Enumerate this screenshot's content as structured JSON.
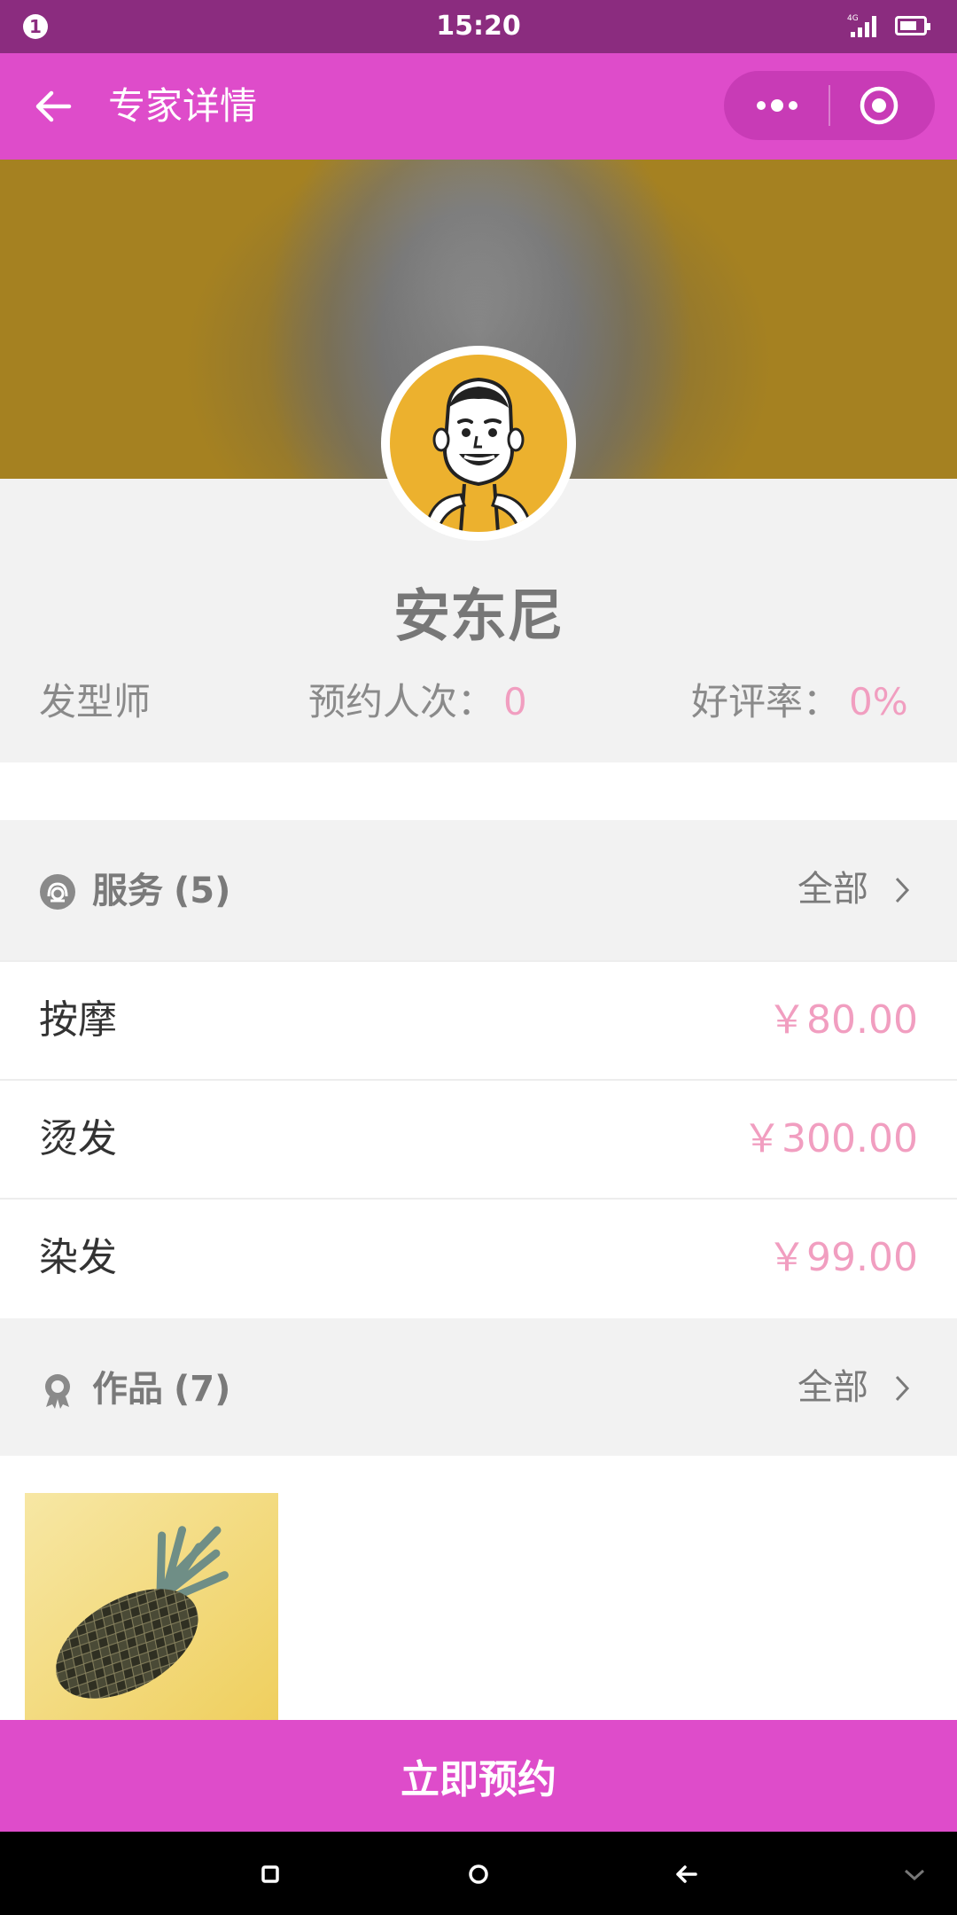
{
  "status_bar": {
    "notification": "1",
    "time": "15:20",
    "network": "4G"
  },
  "nav": {
    "title": "专家详情"
  },
  "expert": {
    "name": "安东尼",
    "role": "发型师",
    "bookings_label": "预约人次：",
    "bookings_value": "0",
    "rating_label": "好评率：",
    "rating_value": "0%"
  },
  "services": {
    "title": "服务",
    "count": "(5)",
    "more": "全部",
    "items": [
      {
        "name": "按摩",
        "price": "￥80.00"
      },
      {
        "name": "烫发",
        "price": "￥300.00"
      },
      {
        "name": "染发",
        "price": "￥99.00"
      }
    ]
  },
  "works": {
    "title": "作品",
    "count": "(7)",
    "more": "全部"
  },
  "actions": {
    "book": "立即预约"
  },
  "colors": {
    "accent": "#de4cca",
    "status_bar": "#8b2c7f",
    "price": "#f19ec0",
    "avatar_bg": "#ecb12e"
  },
  "icons": {
    "back": "arrow-left-icon",
    "more": "more-dots-icon",
    "close": "target-icon",
    "services": "service-icon",
    "works": "badge-icon"
  }
}
